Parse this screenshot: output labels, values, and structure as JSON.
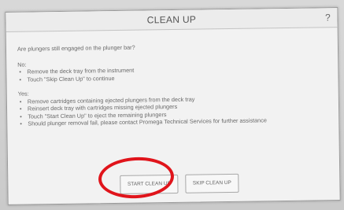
{
  "dialog": {
    "title": "CLEAN UP",
    "help": "?"
  },
  "content": {
    "question": "Are plungers still engaged on the plunger bar?",
    "no": {
      "heading": "No:",
      "items": [
        "Remove the deck tray from the instrument",
        "Touch \"Skip Clean Up\" to continue"
      ]
    },
    "yes": {
      "heading": "Yes:",
      "items": [
        "Remove cartridges containing ejected plungers from the deck tray",
        "Reinsert deck tray  with cartridges missing ejected plungers",
        "Touch \"Start Clean Up\" to eject the remaining plungers",
        "Should plunger removal fail, please contact Promega Technical Services for further assistance"
      ]
    }
  },
  "buttons": {
    "start": "START CLEAN UP",
    "skip": "SKIP CLEAN UP"
  },
  "colors": {
    "highlight": "#e0141b"
  }
}
